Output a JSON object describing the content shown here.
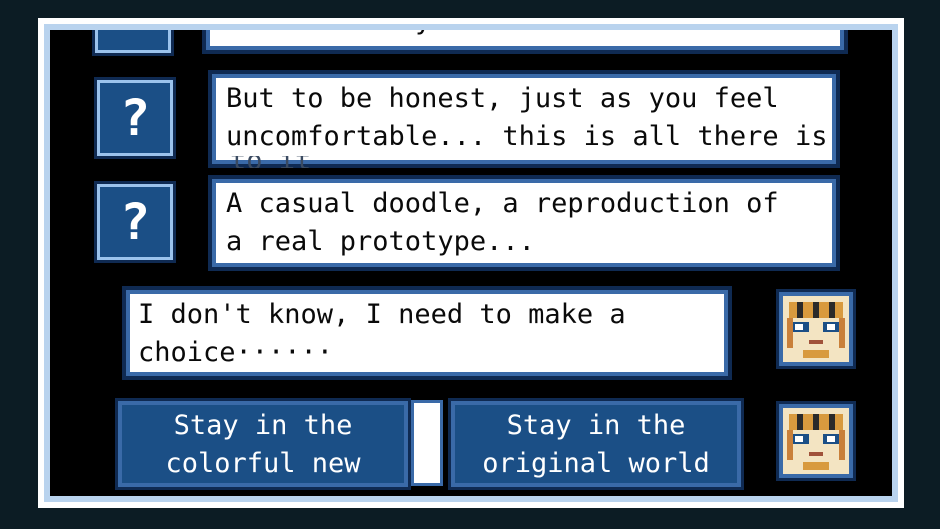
{
  "dialog": {
    "top_partial": "can do that yourself.",
    "messages": [
      {
        "speaker_icon": "?",
        "lines": [
          "But to be honest, just as you feel",
          "uncomfortable... this is all there is",
          "to it"
        ]
      },
      {
        "speaker_icon": "?",
        "lines": [
          "A casual doodle, a reproduction of",
          "a real prototype..."
        ]
      }
    ],
    "player_message": {
      "lines": [
        "I don't know, I need to make a",
        "choice······"
      ]
    }
  },
  "choices": [
    {
      "lines": [
        "Stay in the",
        "colorful new world"
      ]
    },
    {
      "lines": [
        "Stay in the",
        "original world"
      ]
    }
  ],
  "colors": {
    "bubble_border": "#3a6aa8",
    "choice_bg": "#1b4f86",
    "screen_bg": "#000000",
    "frame": "#b9d3ee"
  }
}
